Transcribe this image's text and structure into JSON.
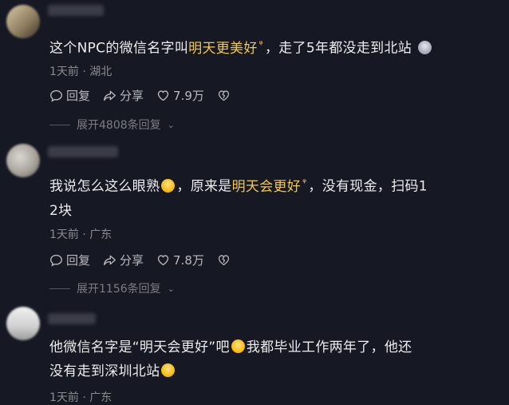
{
  "comments": [
    {
      "text_a": "这个NPC的微信名字叫",
      "highlight": "明天更美好",
      "text_b": "，走了5年都没走到北站",
      "time_loc": "1天前 · 湖北",
      "reply": "回复",
      "share": "分享",
      "likes": "7.9万",
      "expand": "展开4808条回复",
      "trailing_emoji": "sad-face-emoji"
    },
    {
      "text_a": "我说怎么这么眼熟",
      "text_mid": "，原来是",
      "highlight": "明天会更好",
      "text_b": "，没有现金，扫码1",
      "text_c": "2块",
      "time_loc": "1天前 · 广东",
      "reply": "回复",
      "share": "分享",
      "likes": "7.8万",
      "expand": "展开1156条回复",
      "inline_emoji": "laughing-emoji"
    },
    {
      "text_a": "他微信名字是“明天会更好”吧",
      "text_b": "我都毕业工作两年了，他还",
      "text_c": "没有走到深圳北站",
      "time_loc": "1天前 · 广东",
      "inline_emoji": "laughing-emoji"
    }
  ],
  "colors": {
    "background": "#161823",
    "highlight": "#f2c94c",
    "meta": "#8a8b91"
  }
}
